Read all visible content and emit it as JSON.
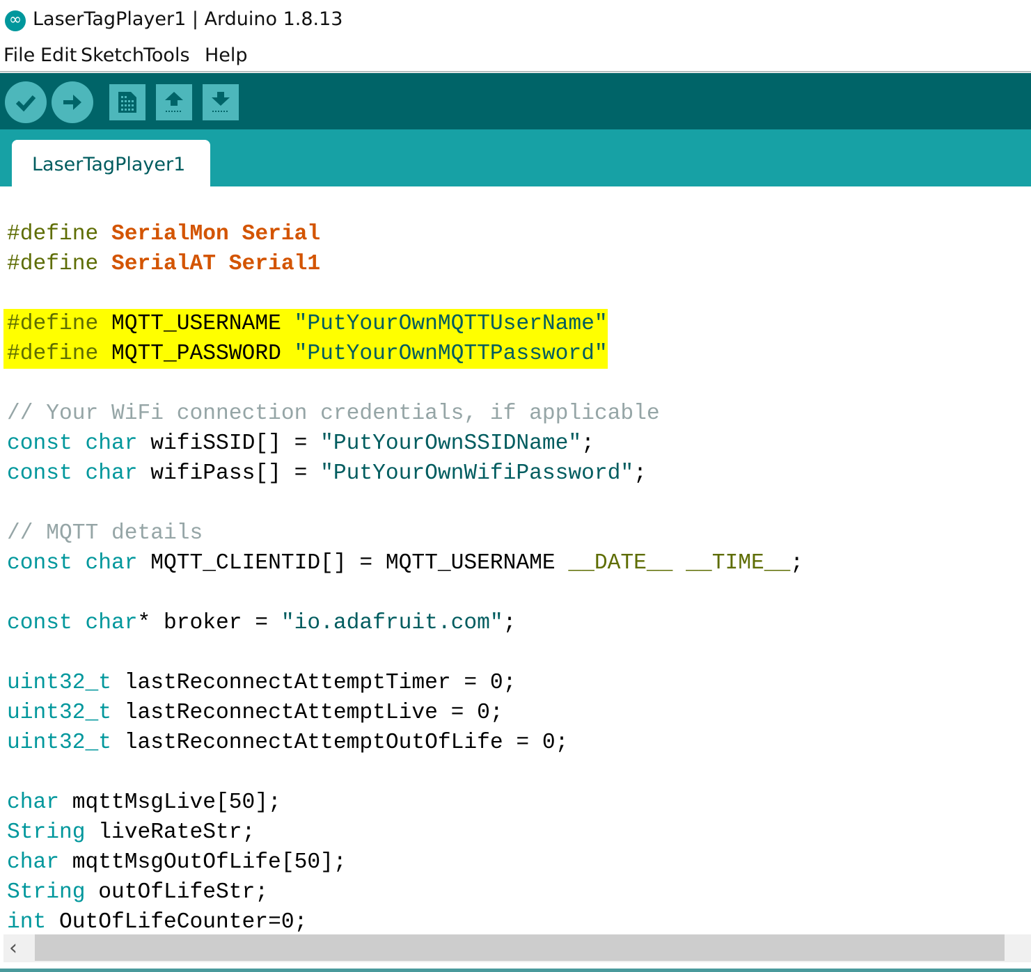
{
  "window": {
    "title": "LaserTagPlayer1 | Arduino 1.8.13",
    "icon": "arduino-logo-icon"
  },
  "menu": [
    "File",
    "Edit",
    "Sketch",
    "Tools",
    "Help"
  ],
  "toolbar": [
    {
      "name": "verify-button",
      "icon": "checkmark-icon"
    },
    {
      "name": "upload-button",
      "icon": "arrow-right-icon"
    },
    {
      "name": "new-button",
      "icon": "document-icon"
    },
    {
      "name": "open-button",
      "icon": "arrow-up-icon"
    },
    {
      "name": "save-button",
      "icon": "arrow-down-icon"
    }
  ],
  "tab": {
    "label": "LaserTagPlayer1"
  },
  "colors": {
    "toolbar": "#006468",
    "tabbar": "#17a1a5",
    "keyword": "#00979c",
    "highlight": "#ffff00"
  },
  "code": [
    {
      "row": 1,
      "tokens": [
        [
          "pp",
          "#define "
        ],
        [
          "kw2",
          "SerialMon Serial"
        ]
      ]
    },
    {
      "row": 2,
      "tokens": [
        [
          "pp",
          "#define "
        ],
        [
          "kw2",
          "SerialAT Serial1"
        ]
      ]
    },
    {
      "row": 4,
      "hl": true,
      "tokens": [
        [
          "pp",
          "#define "
        ],
        [
          "pl",
          "MQTT_USERNAME "
        ],
        [
          "str",
          "\"PutYourOwnMQTTUserName\""
        ]
      ]
    },
    {
      "row": 5,
      "hl": true,
      "tokens": [
        [
          "pp",
          "#define "
        ],
        [
          "pl",
          "MQTT_PASSWORD "
        ],
        [
          "str",
          "\"PutYourOwnMQTTPassword\""
        ]
      ]
    },
    {
      "row": 7,
      "tokens": [
        [
          "cm",
          "// Your WiFi connection credentials, if applicable"
        ]
      ]
    },
    {
      "row": 8,
      "tokens": [
        [
          "kw",
          "const char "
        ],
        [
          "pl",
          "wifiSSID[] = "
        ],
        [
          "str",
          "\"PutYourOwnSSIDName\""
        ],
        [
          "pl",
          ";"
        ]
      ]
    },
    {
      "row": 9,
      "tokens": [
        [
          "kw",
          "const char "
        ],
        [
          "pl",
          "wifiPass[] = "
        ],
        [
          "str",
          "\"PutYourOwnWifiPassword\""
        ],
        [
          "pl",
          ";"
        ]
      ]
    },
    {
      "row": 11,
      "tokens": [
        [
          "cm",
          "// MQTT details"
        ]
      ]
    },
    {
      "row": 12,
      "tokens": [
        [
          "kw",
          "const char "
        ],
        [
          "pl",
          "MQTT_CLIENTID[] = MQTT_USERNAME "
        ],
        [
          "lit",
          "__DATE__ __TIME__"
        ],
        [
          "pl",
          ";"
        ]
      ]
    },
    {
      "row": 14,
      "tokens": [
        [
          "kw",
          "const char"
        ],
        [
          "pl",
          "* broker = "
        ],
        [
          "str",
          "\"io.adafruit.com\""
        ],
        [
          "pl",
          ";"
        ]
      ]
    },
    {
      "row": 16,
      "tokens": [
        [
          "kw",
          "uint32_t "
        ],
        [
          "pl",
          "lastReconnectAttemptTimer = 0;"
        ]
      ]
    },
    {
      "row": 17,
      "tokens": [
        [
          "kw",
          "uint32_t "
        ],
        [
          "pl",
          "lastReconnectAttemptLive = 0;"
        ]
      ]
    },
    {
      "row": 18,
      "tokens": [
        [
          "kw",
          "uint32_t "
        ],
        [
          "pl",
          "lastReconnectAttemptOutOfLife = 0;"
        ]
      ]
    },
    {
      "row": 20,
      "tokens": [
        [
          "kw",
          "char "
        ],
        [
          "pl",
          "mqttMsgLive[50];"
        ]
      ]
    },
    {
      "row": 21,
      "tokens": [
        [
          "kw",
          "String "
        ],
        [
          "pl",
          "liveRateStr;"
        ]
      ]
    },
    {
      "row": 22,
      "tokens": [
        [
          "kw",
          "char "
        ],
        [
          "pl",
          "mqttMsgOutOfLife[50];"
        ]
      ]
    },
    {
      "row": 23,
      "tokens": [
        [
          "kw",
          "String "
        ],
        [
          "pl",
          "outOfLifeStr;"
        ]
      ]
    },
    {
      "row": 24,
      "tokens": [
        [
          "kw",
          "int "
        ],
        [
          "pl",
          "OutOfLifeCounter=0;"
        ]
      ]
    }
  ]
}
